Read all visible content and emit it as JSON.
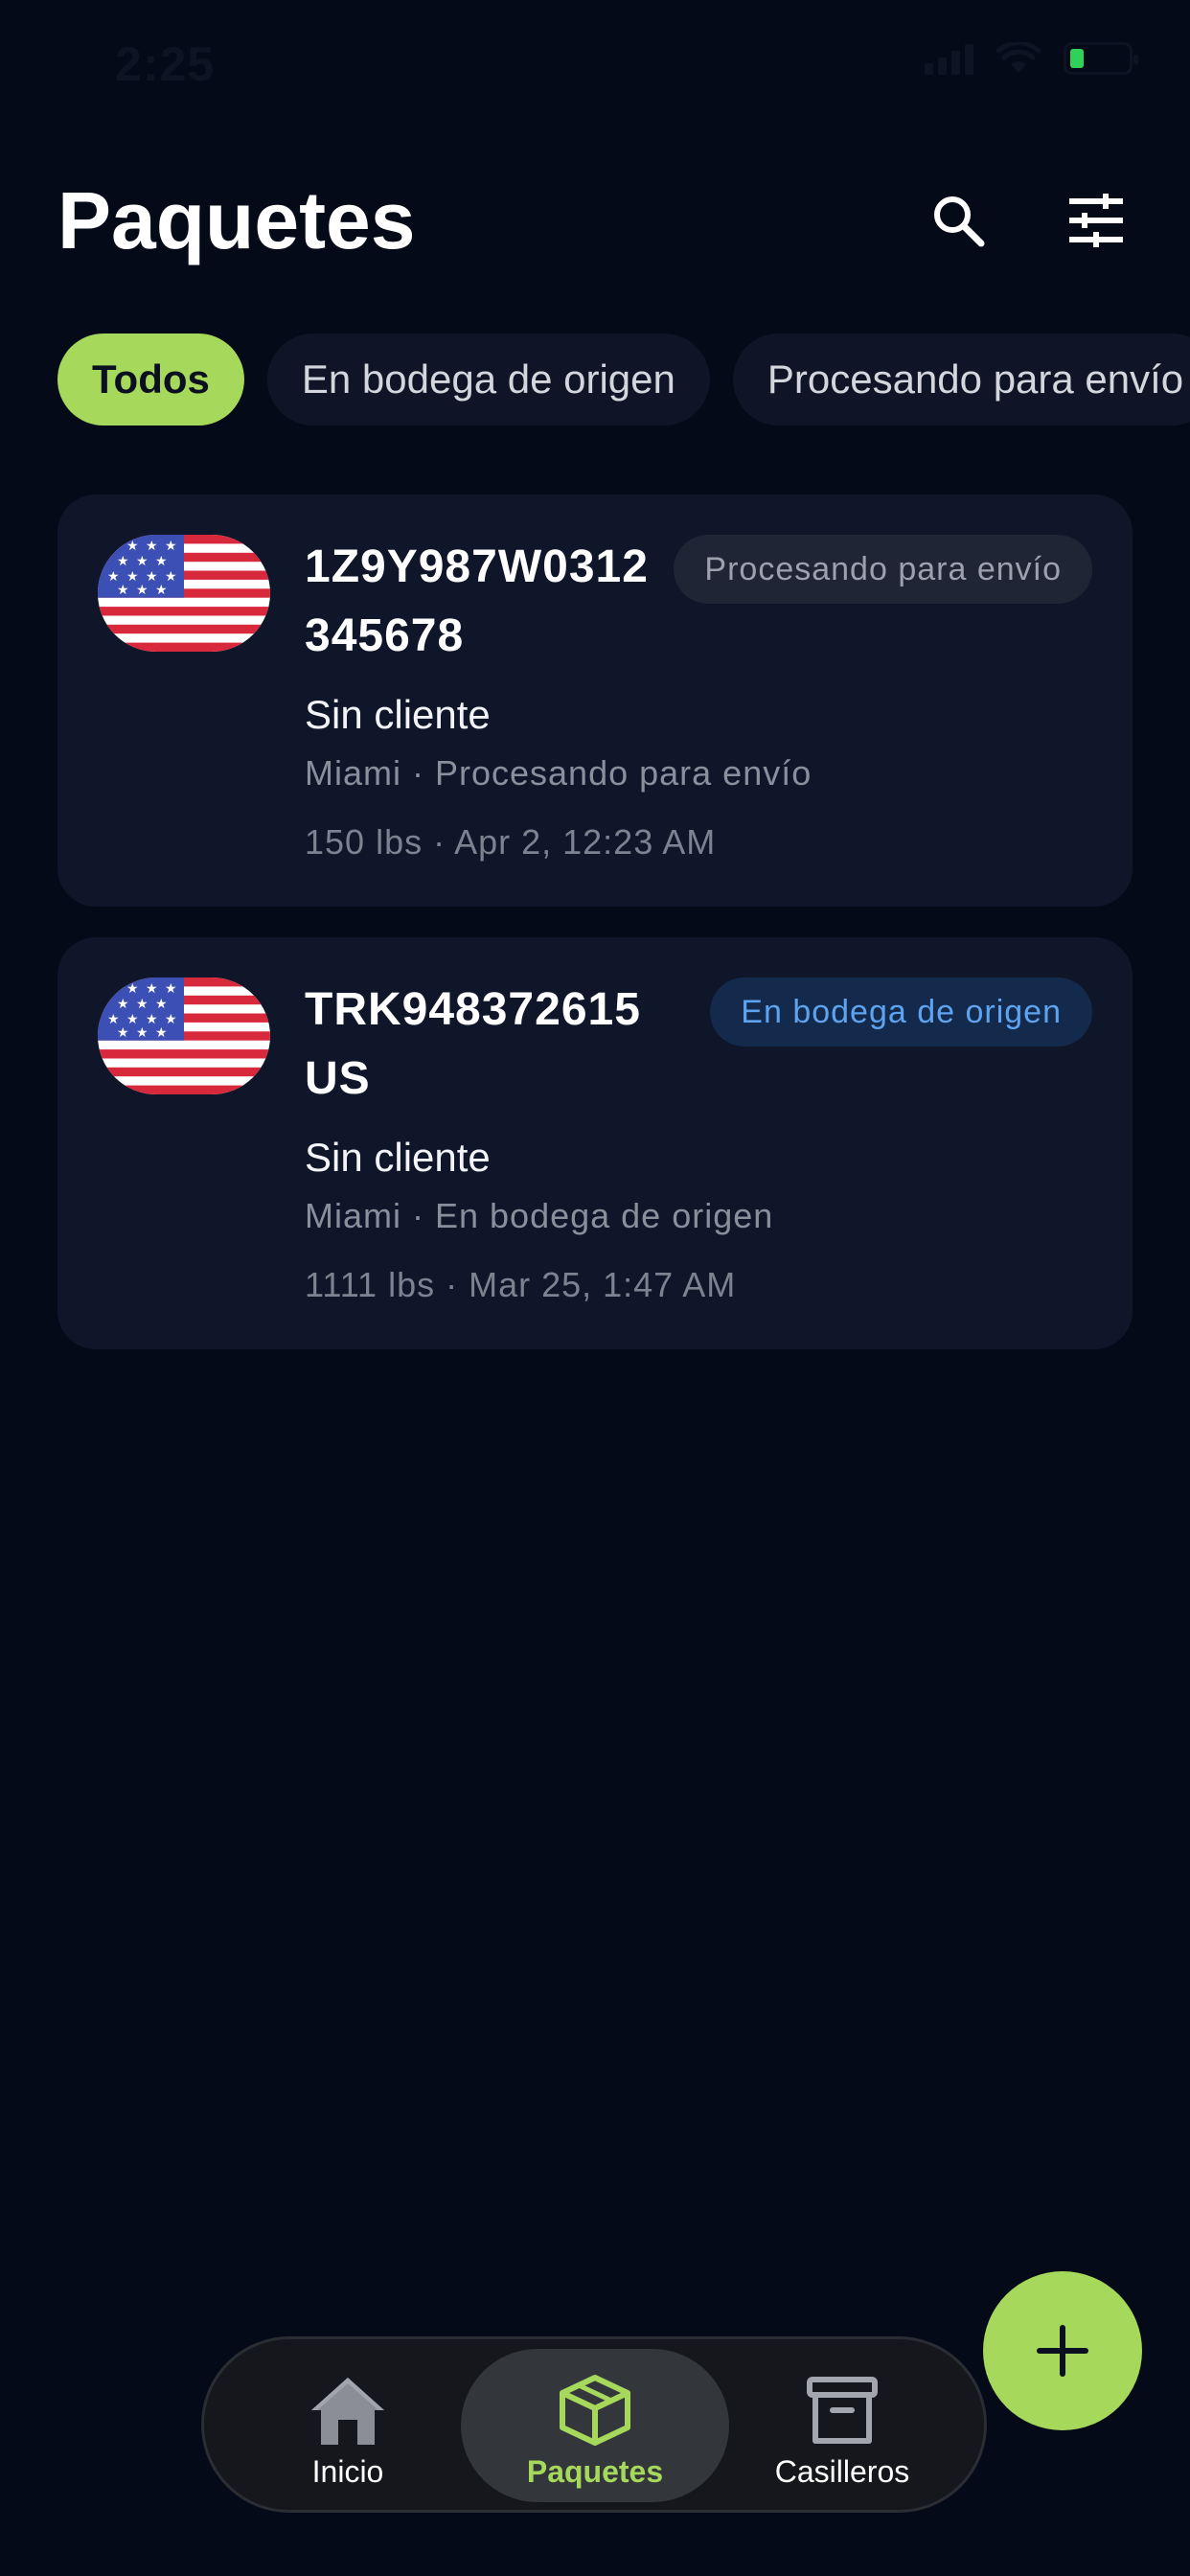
{
  "status_bar": {
    "time": "2:25"
  },
  "header": {
    "title": "Paquetes"
  },
  "filters": [
    {
      "label": "Todos",
      "active": true
    },
    {
      "label": "En bodega de origen",
      "active": false
    },
    {
      "label": "Procesando para envío",
      "active": false
    }
  ],
  "packages": [
    {
      "tracking": "1Z9Y987W0312345678",
      "status_badge": "Procesando para envío",
      "client": "Sin cliente",
      "location": "Miami · Procesando para envío",
      "meta": "150 lbs · Apr 2, 12:23 AM",
      "flag": "us-flag-icon"
    },
    {
      "tracking": "TRK948372615US",
      "status_badge": "En bodega de origen",
      "client": "Sin cliente",
      "location": "Miami · En bodega de origen",
      "meta": "1111 lbs · Mar 25, 1:47 AM",
      "flag": "us-flag-icon"
    }
  ],
  "nav": {
    "home": "Inicio",
    "packages": "Paquetes",
    "lockers": "Casilleros"
  },
  "colors": {
    "background": "#050a18",
    "card": "#10162a",
    "accent": "#a6d95b",
    "badge_origin_text": "#5ea3f0",
    "badge_processing_text": "#9ca1ad"
  },
  "icons": {
    "search": "search-icon",
    "filter": "sliders-icon",
    "fab": "plus-icon",
    "home": "house-icon",
    "packages": "box-icon",
    "lockers": "archive-icon"
  }
}
